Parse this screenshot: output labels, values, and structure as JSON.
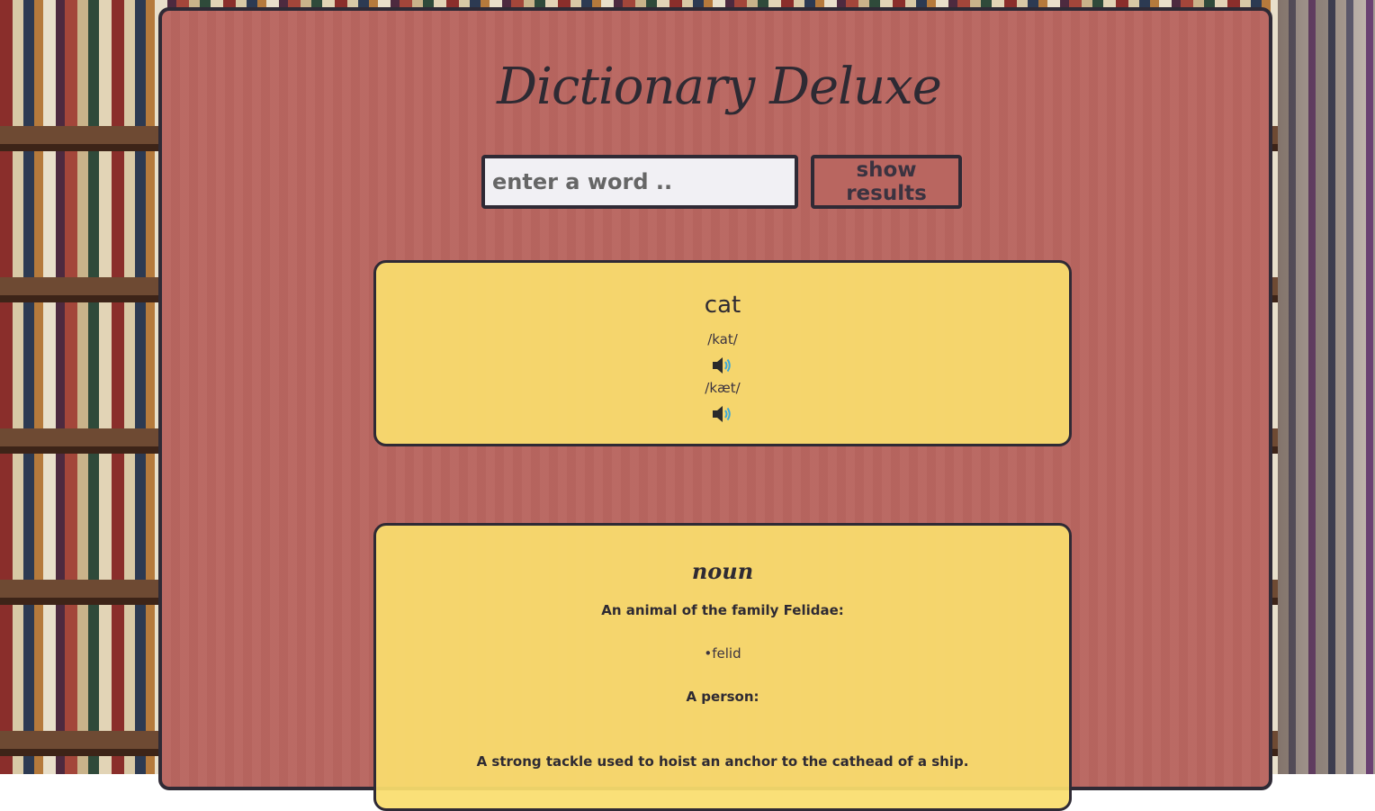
{
  "app": {
    "title": "Dictionary Deluxe"
  },
  "search": {
    "placeholder": "enter a word ..",
    "value": "",
    "button_label": "show results"
  },
  "entry": {
    "word": "cat",
    "phonetics": [
      {
        "text": "/kat/",
        "audio_icon": "speaker-icon"
      },
      {
        "text": "/kæt/",
        "audio_icon": "speaker-icon"
      }
    ]
  },
  "meanings": [
    {
      "part_of_speech": "noun",
      "definitions": [
        {
          "definition": "An animal of the family Felidae:",
          "synonym": "•felid"
        },
        {
          "definition": "A person:",
          "synonym": ""
        },
        {
          "definition": "A strong tackle used to hoist an anchor to the cathead of a ship.",
          "synonym": ""
        }
      ]
    }
  ],
  "colors": {
    "panel_bg": "#b96660",
    "card_bg": "#fade6e",
    "border": "#2f2a35",
    "audio_accent": "#3aa7d9"
  }
}
